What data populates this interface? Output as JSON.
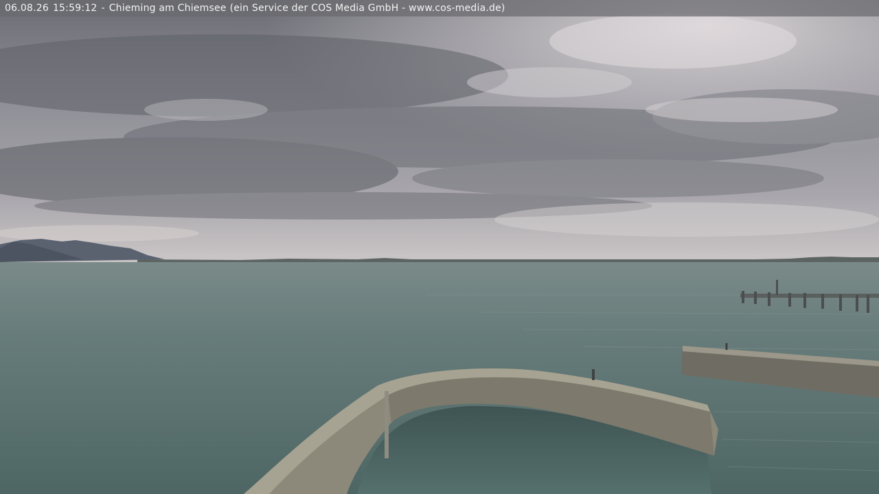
{
  "overlay": {
    "date": "06.08.26",
    "time": "15:59:12",
    "location": "Chieming am Chiemsee",
    "service_note": "(ein Service der COS Media GmbH - www.cos-media.de)"
  },
  "colors": {
    "sky_top": "#6f7177",
    "sky_mid": "#9a9aa2",
    "sky_horizon": "#c6c2c4",
    "water_far": "#6f807f",
    "water_near": "#4f6765",
    "stone": "#8d8a7c"
  }
}
